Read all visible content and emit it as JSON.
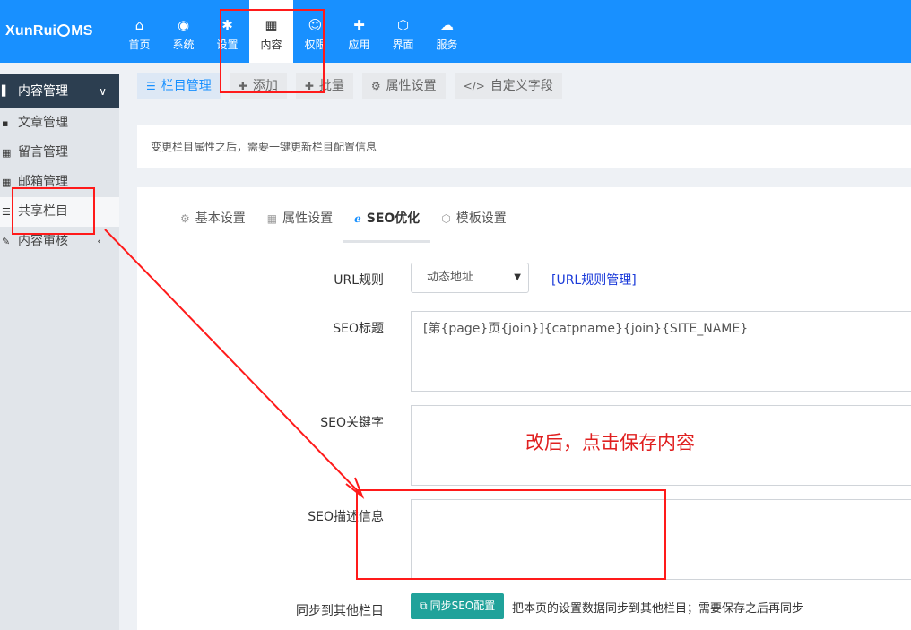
{
  "brand": {
    "logo_left": "XunRui",
    "logo_right": "MS"
  },
  "nav": [
    {
      "icon": "home-icon",
      "glyph": "⌂",
      "label": "首页"
    },
    {
      "icon": "globe-icon",
      "glyph": "◉",
      "label": "系统"
    },
    {
      "icon": "cogs-icon",
      "glyph": "✱",
      "label": "设置"
    },
    {
      "icon": "grid-icon",
      "glyph": "▦",
      "label": "内容"
    },
    {
      "icon": "user-circle-icon",
      "glyph": "☺",
      "label": "权限"
    },
    {
      "icon": "puzzle-icon",
      "glyph": "✚",
      "label": "应用"
    },
    {
      "icon": "html5-icon",
      "glyph": "⬡",
      "label": "界面"
    },
    {
      "icon": "cloud-icon",
      "glyph": "☁",
      "label": "服务"
    }
  ],
  "active_nav": "内容",
  "sidebar": {
    "header": {
      "icon": "file-icon",
      "label": "内容管理"
    },
    "items": [
      {
        "icon": "sticky-note-icon",
        "glyph": "▪",
        "label": "文章管理"
      },
      {
        "icon": "table-icon",
        "glyph": "▦",
        "label": "留言管理"
      },
      {
        "icon": "table-icon",
        "glyph": "▦",
        "label": "邮箱管理"
      },
      {
        "icon": "list-icon",
        "glyph": "☰",
        "label": "共享栏目"
      },
      {
        "icon": "edit-icon",
        "glyph": "✎",
        "label": "内容审核"
      }
    ]
  },
  "toolbar": [
    {
      "icon": "list-icon",
      "glyph": "☰",
      "label": "栏目管理",
      "primary": true
    },
    {
      "icon": "plus-icon",
      "glyph": "✚",
      "label": "添加"
    },
    {
      "icon": "plus-icon",
      "glyph": "✚",
      "label": "批量"
    },
    {
      "icon": "gear-icon",
      "glyph": "⚙",
      "label": "属性设置"
    },
    {
      "icon": "code-icon",
      "glyph": "</>",
      "label": "自定义字段"
    }
  ],
  "notice": "变更栏目属性之后，需要一键更新栏目配置信息",
  "tabs": [
    {
      "icon": "gear-icon",
      "glyph": "⚙",
      "label": "基本设置"
    },
    {
      "icon": "table-icon",
      "glyph": "▦",
      "label": "属性设置"
    },
    {
      "icon": "ie-icon",
      "glyph": "ℯ",
      "label": "SEO优化",
      "active": true
    },
    {
      "icon": "html5-icon",
      "glyph": "⬡",
      "label": "模板设置"
    }
  ],
  "form": {
    "url_rule_label": "URL规则",
    "url_rule_value": "动态地址",
    "url_rule_link": "[URL规则管理]",
    "seo_title_label": "SEO标题",
    "seo_title_value": "[第{page}页{join}]{catpname}{join}{SITE_NAME}",
    "seo_keywords_label": "SEO关键字",
    "seo_keywords_value": "",
    "seo_desc_label": "SEO描述信息",
    "seo_desc_value": "",
    "sync_label": "同步到其他栏目",
    "sync_button": "同步SEO配置",
    "sync_tip": "把本页的设置数据同步到其他栏目；需要保存之后再同步"
  },
  "annotation": {
    "text": "改后，点击保存内容",
    "color": "#ff1a1a"
  }
}
